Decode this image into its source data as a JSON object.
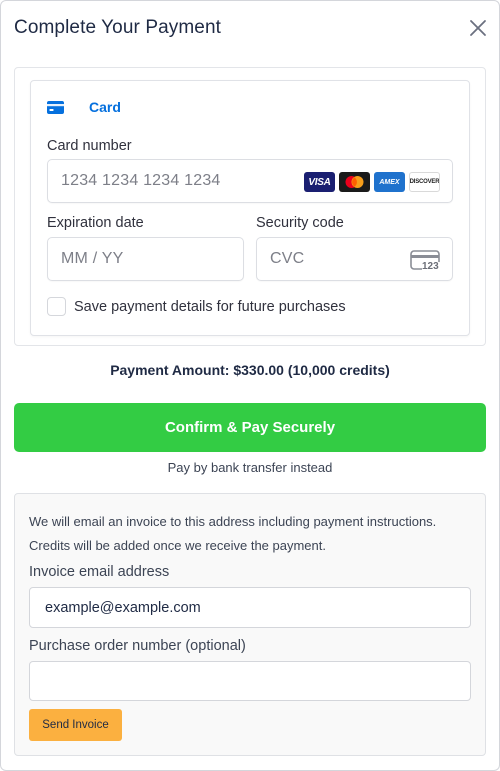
{
  "dialog": {
    "title": "Complete Your Payment"
  },
  "payment_method": {
    "tab_label": "Card",
    "card_number": {
      "label": "Card number",
      "placeholder": "1234 1234 1234 1234",
      "brands": [
        "VISA",
        "mastercard",
        "AMEX",
        "DISCOVER"
      ]
    },
    "expiration": {
      "label": "Expiration date",
      "placeholder": "MM / YY"
    },
    "security_code": {
      "label": "Security code",
      "placeholder": "CVC",
      "icon_text": "123"
    },
    "save_details_label": "Save payment details for future purchases",
    "save_details_checked": false
  },
  "summary": {
    "amount_text": "Payment Amount: $330.00 (10,000 credits)"
  },
  "actions": {
    "confirm_label": "Confirm & Pay Securely",
    "bank_transfer_link": "Pay by bank transfer instead"
  },
  "invoice": {
    "note_line1": "We will email an invoice to this address including payment instructions.",
    "note_line2": "Credits will be added once we receive the payment.",
    "email_label": "Invoice email address",
    "email_value": "example@example.com",
    "po_label": "Purchase order number (optional)",
    "po_value": "",
    "send_label": "Send Invoice"
  },
  "colors": {
    "accent_blue": "#0570de",
    "confirm_green": "#33cc44",
    "send_orange": "#fbb040",
    "title_navy": "#1f2a44"
  }
}
